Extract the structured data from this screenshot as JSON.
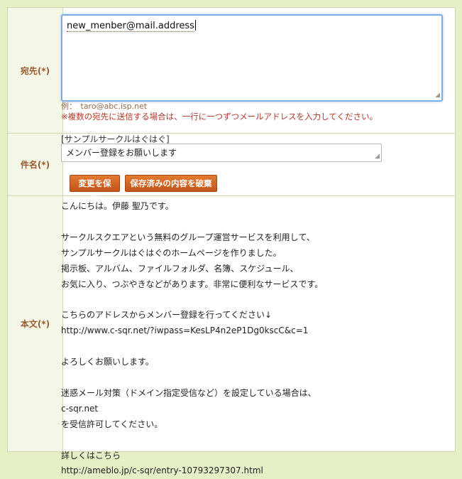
{
  "to": {
    "label": "宛先(*)",
    "value": "new_menber@mail.address",
    "example": "例：　taro@abc.isp.net",
    "note": "※複数の宛先に送信する場合は、一行に一つずつメールアドレスを入力してください。"
  },
  "subject": {
    "label": "件名(*)",
    "prefix": "[サンプルサークルはぐはぐ]",
    "value": "メンバー登録をお願いします",
    "save_button": "変更を保存",
    "discard_button": "保存済みの内容を破棄"
  },
  "body": {
    "label": "本文(*)",
    "lines": [
      "こんにちは。伊藤 聖乃です。",
      "",
      "サークルスクエアという無料のグループ運営サービスを利用して、",
      "サンプルサークルはぐはぐのホームページを作りました。",
      "掲示板、アルバム、ファイルフォルダ、名簿、スケジュール、",
      "お気に入り、つぶやきなどがあります。非常に便利なサービスです。",
      "",
      "こちらのアドレスからメンバー登録を行ってください↓",
      "http://www.c-sqr.net/?iwpass=KesLP4n2eP1Dg0kscC&c=1",
      "",
      "よろしくお願いします。",
      "",
      "迷惑メール対策（ドメイン指定受信など）を設定している場合は、",
      "c-sqr.net",
      "を受信許可してください。",
      "",
      "詳しくはこちら",
      "http://ameblo.jp/c-sqr/entry-10793297307.html"
    ]
  }
}
